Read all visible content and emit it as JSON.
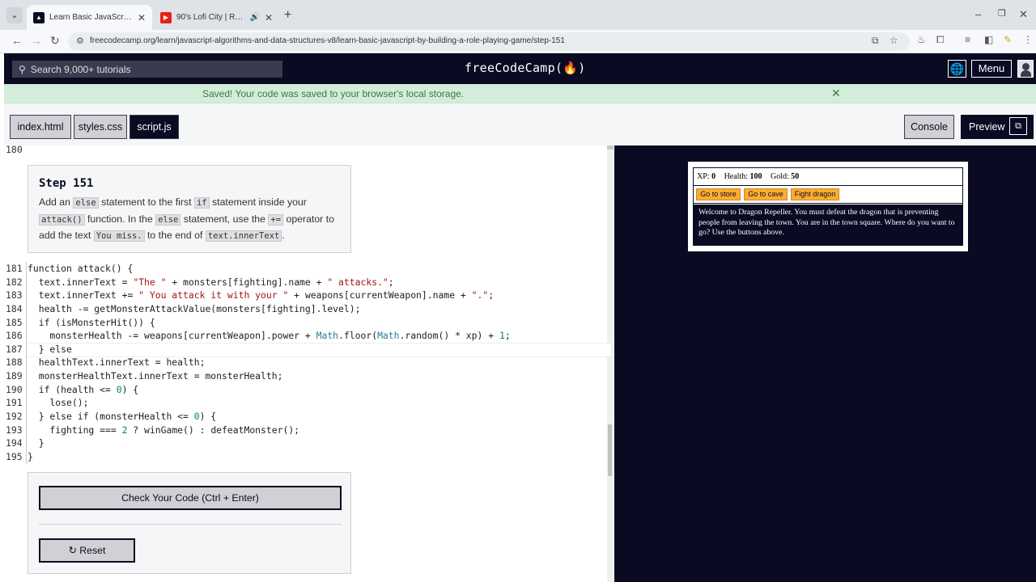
{
  "browser": {
    "tabs": [
      {
        "title": "Learn Basic JavaScript by Building",
        "favicon": "freecodecamp-icon",
        "active": true
      },
      {
        "title": "90's Lofi City",
        "subtitle": "Rainy Lofi",
        "favicon": "youtube-icon",
        "active": false
      }
    ],
    "url": "freecodecamp.org/learn/javascript-algorithms-and-data-structures-v8/learn-basic-javascript-by-building-a-role-playing-game/step-151"
  },
  "fcc": {
    "search_placeholder": "Search 9,000+ tutorials",
    "logo": "freeCodeCamp(🔥)",
    "menu_label": "Menu"
  },
  "alert": {
    "message": "Saved! Your code was saved to your browser's local storage.",
    "color": "#d4edda"
  },
  "editor_tabs": {
    "files": [
      "index.html",
      "styles.css",
      "script.js"
    ],
    "active_file": "script.js",
    "console_label": "Console",
    "preview_label": "Preview"
  },
  "editor": {
    "first_line_number": "180",
    "step": {
      "title": "Step 151",
      "parts": [
        "Add an ",
        "else",
        " statement to the first ",
        "if",
        " statement inside your ",
        "attack()",
        " function. In the ",
        "else",
        " statement, use the ",
        "+=",
        " operator to add the text ",
        "You miss.",
        " to the end of ",
        "text.innerText",
        "."
      ]
    },
    "code_lines": [
      {
        "n": "181",
        "t": "function attack() {"
      },
      {
        "n": "182",
        "t": "  text.innerText = \"The \" + monsters[fighting].name + \" attacks.\";"
      },
      {
        "n": "183",
        "t": "  text.innerText += \" You attack it with your \" + weapons[currentWeapon].name + \".\";"
      },
      {
        "n": "184",
        "t": "  health -= getMonsterAttackValue(monsters[fighting].level);"
      },
      {
        "n": "185",
        "t": "  if (isMonsterHit()) {"
      },
      {
        "n": "186",
        "t": "    monsterHealth -= weapons[currentWeapon].power + Math.floor(Math.random() * xp) + 1;"
      },
      {
        "n": "187",
        "t": "  } else"
      },
      {
        "n": "188",
        "t": "  healthText.innerText = health;"
      },
      {
        "n": "189",
        "t": "  monsterHealthText.innerText = monsterHealth;"
      },
      {
        "n": "190",
        "t": "  if (health <= 0) {"
      },
      {
        "n": "191",
        "t": "    lose();"
      },
      {
        "n": "192",
        "t": "  } else if (monsterHealth <= 0) {"
      },
      {
        "n": "193",
        "t": "    fighting === 2 ? winGame() : defeatMonster();"
      },
      {
        "n": "194",
        "t": "  }"
      },
      {
        "n": "195",
        "t": "}"
      }
    ],
    "current_line": "187",
    "check_label": "Check Your Code (Ctrl + Enter)",
    "reset_label": "Reset"
  },
  "game": {
    "xp_label": "XP:",
    "xp": "0",
    "health_label": "Health:",
    "health": "100",
    "gold_label": "Gold:",
    "gold": "50",
    "buttons": [
      "Go to store",
      "Go to cave",
      "Fight dragon"
    ],
    "text": "Welcome to Dragon Repeller. You must defeat the dragon that is preventing people from leaving the town. You are in the town square. Where do you want to go? Use the buttons above.",
    "button_color": "#feac32"
  }
}
